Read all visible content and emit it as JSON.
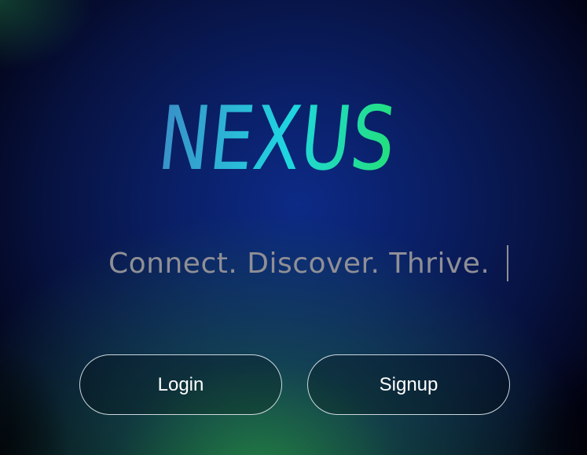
{
  "logo": {
    "text": "NEXUS",
    "gradient": [
      "#3a8fc8",
      "#1fd6e0",
      "#22e07a"
    ]
  },
  "tagline": {
    "text": "Connect. Discover. Thrive."
  },
  "buttons": {
    "login_label": "Login",
    "signup_label": "Signup"
  },
  "colors": {
    "background_center": "#0c2a86",
    "background_glow": "#2a9646",
    "tagline": "#8f8f96",
    "button_border": "#e1ebf0"
  }
}
